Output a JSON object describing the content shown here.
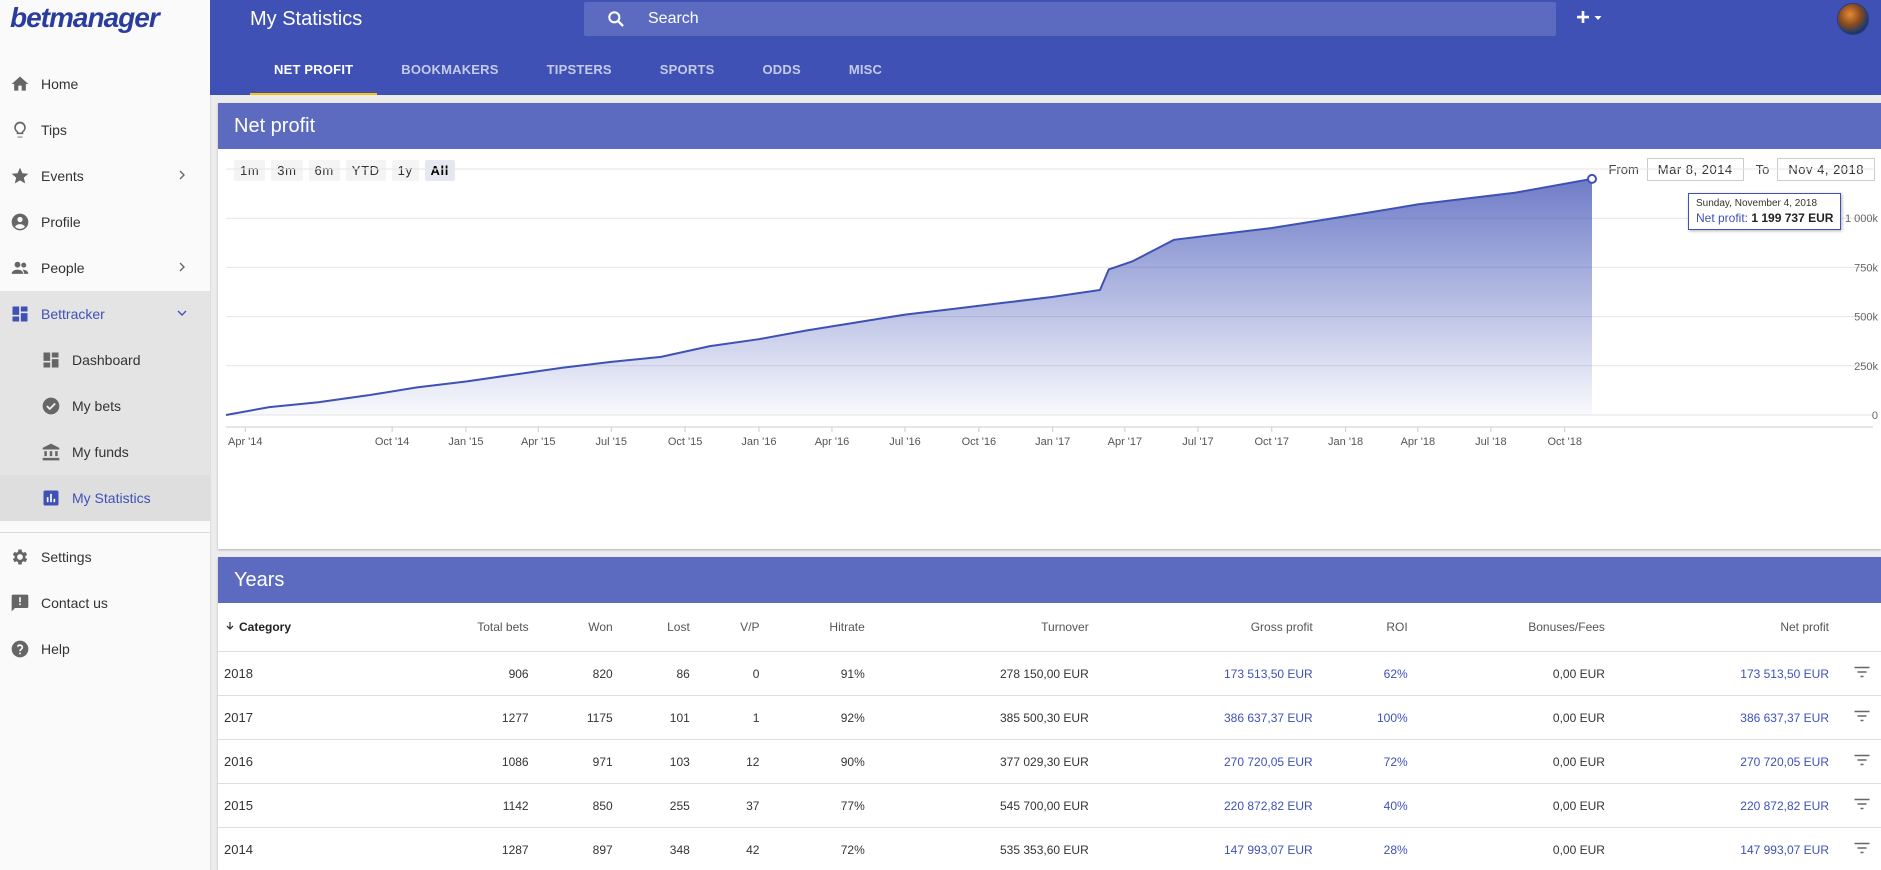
{
  "app": {
    "logo_text": "betmanager",
    "page_title": "My Statistics",
    "search_placeholder": "Search",
    "add_label": "+"
  },
  "sidebar": {
    "items": [
      {
        "label": "Home",
        "icon": "home-icon"
      },
      {
        "label": "Tips",
        "icon": "lightbulb-icon"
      },
      {
        "label": "Events",
        "icon": "star-icon"
      },
      {
        "label": "Profile",
        "icon": "account-circle-icon"
      },
      {
        "label": "People",
        "icon": "people-icon"
      },
      {
        "label": "Bettracker",
        "icon": "dashboard-icon"
      },
      {
        "label": "Dashboard",
        "icon": "dashboard-icon"
      },
      {
        "label": "My bets",
        "icon": "check-circle-icon"
      },
      {
        "label": "My funds",
        "icon": "bank-icon"
      },
      {
        "label": "My Statistics",
        "icon": "bar-chart-icon"
      },
      {
        "label": "Settings",
        "icon": "gear-icon"
      },
      {
        "label": "Contact us",
        "icon": "feedback-icon"
      },
      {
        "label": "Help",
        "icon": "help-icon"
      }
    ]
  },
  "tabs": [
    "NET PROFIT",
    "BOOKMAKERS",
    "TIPSTERS",
    "SPORTS",
    "ODDS",
    "MISC"
  ],
  "net_profit": {
    "title": "Net profit",
    "ranges": [
      "1m",
      "3m",
      "6m",
      "YTD",
      "1y",
      "All"
    ],
    "active_range": "All",
    "from_label": "From",
    "from_value": "Mar 8, 2014",
    "to_label": "To",
    "to_value": "Nov 4, 2018",
    "tooltip": {
      "date": "Sunday, November 4, 2018",
      "label": "Net profit:",
      "value": "1 199 737 EUR"
    }
  },
  "chart_data": {
    "type": "area",
    "title": "",
    "xlabel": "",
    "ylabel": "",
    "x_ticks": [
      "Apr '14",
      "Oct '14",
      "Jan '15",
      "Apr '15",
      "Jul '15",
      "Oct '15",
      "Jan '16",
      "Apr '16",
      "Jul '16",
      "Oct '16",
      "Jan '17",
      "Apr '17",
      "Jul '17",
      "Oct '17",
      "Jan '18",
      "Apr '18",
      "Jul '18",
      "Oct '18"
    ],
    "y_ticks": [
      "0",
      "250k",
      "500k",
      "750k",
      "1 000k"
    ],
    "ylim": [
      0,
      1250000
    ],
    "color": "#3f51b5",
    "x": [
      "2014-03-08",
      "2014-05-01",
      "2014-07-01",
      "2014-09-01",
      "2014-11-01",
      "2015-01-01",
      "2015-03-01",
      "2015-05-01",
      "2015-07-01",
      "2015-09-01",
      "2015-11-01",
      "2016-01-01",
      "2016-03-01",
      "2016-05-01",
      "2016-07-01",
      "2016-09-01",
      "2016-11-01",
      "2017-01-01",
      "2017-03-01",
      "2017-03-12",
      "2017-04-10",
      "2017-06-01",
      "2017-08-01",
      "2017-10-01",
      "2017-12-01",
      "2018-02-01",
      "2018-04-01",
      "2018-06-01",
      "2018-08-01",
      "2018-11-04"
    ],
    "values": [
      0,
      40000,
      65000,
      100000,
      140000,
      170000,
      205000,
      240000,
      270000,
      295000,
      350000,
      385000,
      430000,
      470000,
      510000,
      540000,
      570000,
      600000,
      635000,
      740000,
      780000,
      890000,
      920000,
      950000,
      990000,
      1030000,
      1070000,
      1100000,
      1130000,
      1199737
    ]
  },
  "years": {
    "title": "Years",
    "columns": [
      "Category",
      "Total bets",
      "Won",
      "Lost",
      "V/P",
      "Hitrate",
      "Turnover",
      "Gross profit",
      "ROI",
      "Bonuses/Fees",
      "Net profit"
    ],
    "rows": [
      [
        "2018",
        "906",
        "820",
        "86",
        "0",
        "91%",
        "278 150,00 EUR",
        "173 513,50 EUR",
        "62%",
        "0,00 EUR",
        "173 513,50 EUR"
      ],
      [
        "2017",
        "1277",
        "1175",
        "101",
        "1",
        "92%",
        "385 500,30 EUR",
        "386 637,37 EUR",
        "100%",
        "0,00 EUR",
        "386 637,37 EUR"
      ],
      [
        "2016",
        "1086",
        "971",
        "103",
        "12",
        "90%",
        "377 029,30 EUR",
        "270 720,05 EUR",
        "72%",
        "0,00 EUR",
        "270 720,05 EUR"
      ],
      [
        "2015",
        "1142",
        "850",
        "255",
        "37",
        "77%",
        "545 700,00 EUR",
        "220 872,82 EUR",
        "40%",
        "0,00 EUR",
        "220 872,82 EUR"
      ],
      [
        "2014",
        "1287",
        "897",
        "348",
        "42",
        "72%",
        "535 353,60 EUR",
        "147 993,07 EUR",
        "28%",
        "0,00 EUR",
        "147 993,07 EUR"
      ]
    ]
  }
}
